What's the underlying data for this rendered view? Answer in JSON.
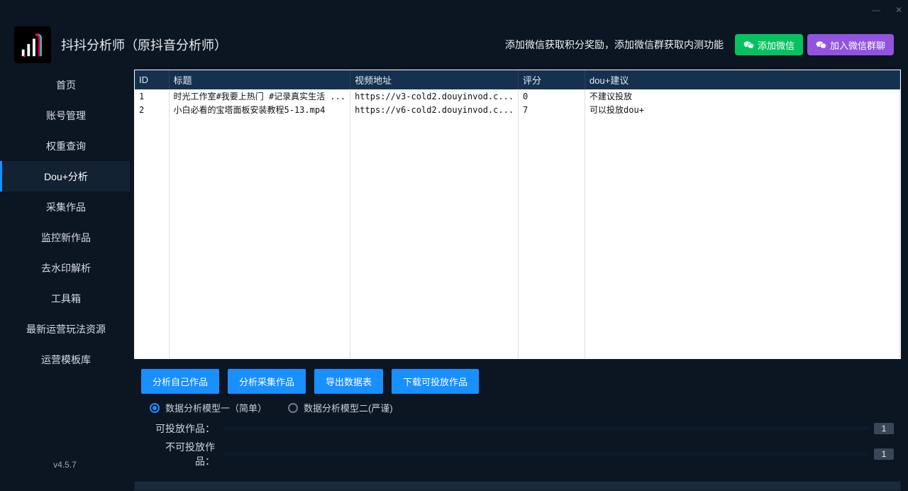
{
  "window": {
    "minimize": "—",
    "close": "✕"
  },
  "header": {
    "app_title": "抖抖分析师（原抖音分析师）",
    "promo_text": "添加微信获取积分奖励，添加微信群获取内测功能",
    "btn_wechat": "添加微信",
    "btn_group": "加入微信群聊"
  },
  "sidebar": {
    "items": [
      "首页",
      "账号管理",
      "权重查询",
      "Dou+分析",
      "采集作品",
      "监控新作品",
      "去水印解析",
      "工具箱",
      "最新运营玩法资源",
      "运营模板库"
    ],
    "active_index": 3,
    "version": "v4.5.7"
  },
  "table": {
    "columns": [
      "ID",
      "标题",
      "视频地址",
      "评分",
      "dou+建议"
    ],
    "rows": [
      {
        "id": "1",
        "title": "时光工作室#我要上热门 #记录真实生活 ...",
        "url": "https://v3-cold2.douyinvod.c...",
        "score": "0",
        "suggest": "不建议投放"
      },
      {
        "id": "2",
        "title": "小白必看的宝塔面板安装教程5-13.mp4",
        "url": "https://v6-cold2.douyinvod.c...",
        "score": "7",
        "suggest": "可以投放dou+"
      }
    ]
  },
  "actions": {
    "analyze_own": "分析自己作品",
    "analyze_collect": "分析采集作品",
    "export": "导出数据表",
    "download": "下载可投放作品"
  },
  "radios": {
    "model1": "数据分析模型一（简单）",
    "model2": "数据分析模型二(严谨)",
    "selected": 0
  },
  "stats": {
    "ok_label": "可投放作品：",
    "ok_count": "1",
    "no_label": "不可投放作品：",
    "no_count": "1"
  }
}
